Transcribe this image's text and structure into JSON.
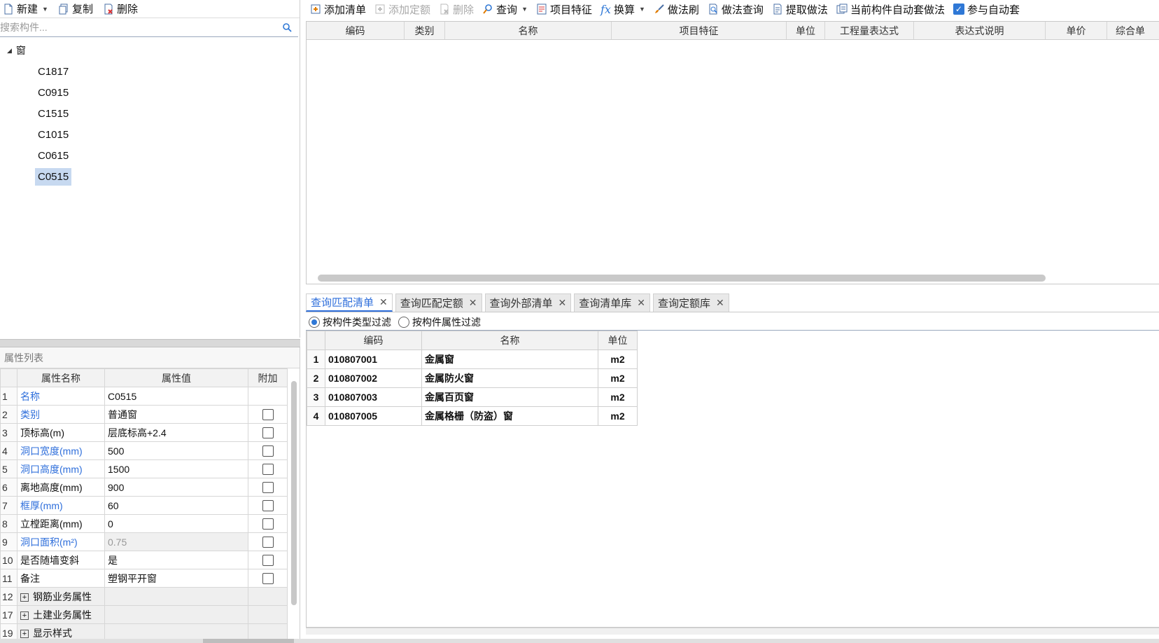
{
  "left_toolbar": {
    "new_label": "新建",
    "copy_label": "复制",
    "delete_label": "删除"
  },
  "search": {
    "placeholder": "搜索构件..."
  },
  "tree": {
    "root_label": "窗",
    "items": [
      "C1817",
      "C0915",
      "C1515",
      "C1015",
      "C0615",
      "C0515"
    ],
    "selected": "C0515"
  },
  "properties": {
    "title": "属性列表",
    "headers": [
      "属性名称",
      "属性值",
      "附加"
    ],
    "rows": [
      {
        "num": "1",
        "name": "名称",
        "value": "C0515",
        "blue": true,
        "checkbox": false,
        "grey": false
      },
      {
        "num": "2",
        "name": "类别",
        "value": "普通窗",
        "blue": true,
        "checkbox": true,
        "grey": false
      },
      {
        "num": "3",
        "name": "顶标高(m)",
        "value": "层底标高+2.4",
        "blue": false,
        "checkbox": true,
        "grey": false
      },
      {
        "num": "4",
        "name": "洞口宽度(mm)",
        "value": "500",
        "blue": true,
        "checkbox": true,
        "grey": false
      },
      {
        "num": "5",
        "name": "洞口高度(mm)",
        "value": "1500",
        "blue": true,
        "checkbox": true,
        "grey": false
      },
      {
        "num": "6",
        "name": "离地高度(mm)",
        "value": "900",
        "blue": false,
        "checkbox": true,
        "grey": false
      },
      {
        "num": "7",
        "name": "框厚(mm)",
        "value": "60",
        "blue": true,
        "checkbox": true,
        "grey": false
      },
      {
        "num": "8",
        "name": "立樘距离(mm)",
        "value": "0",
        "blue": false,
        "checkbox": true,
        "grey": false
      },
      {
        "num": "9",
        "name": "洞口面积(m²)",
        "value": "0.75",
        "blue": true,
        "checkbox": true,
        "grey": true
      },
      {
        "num": "10",
        "name": "是否随墙变斜",
        "value": "是",
        "blue": false,
        "checkbox": true,
        "grey": false
      },
      {
        "num": "11",
        "name": "备注",
        "value": "塑钢平开窗",
        "blue": false,
        "checkbox": true,
        "grey": false
      }
    ],
    "groups": [
      {
        "num": "12",
        "name": "钢筋业务属性"
      },
      {
        "num": "17",
        "name": "土建业务属性"
      },
      {
        "num": "19",
        "name": "显示样式"
      }
    ]
  },
  "right_toolbar": {
    "add_list": "添加清单",
    "add_quota": "添加定额",
    "delete": "删除",
    "query": "查询",
    "item_feature": "项目特征",
    "convert": "换算",
    "method_brush": "做法刷",
    "method_query": "做法查询",
    "extract_method": "提取做法",
    "auto_method": "当前构件自动套做法",
    "auto_apply": "参与自动套"
  },
  "list_grid": {
    "headers": [
      "编码",
      "类别",
      "名称",
      "项目特征",
      "单位",
      "工程量表达式",
      "表达式说明",
      "单价",
      "综合单"
    ]
  },
  "tabs": [
    {
      "label": "查询匹配清单",
      "active": true
    },
    {
      "label": "查询匹配定额",
      "active": false
    },
    {
      "label": "查询外部清单",
      "active": false
    },
    {
      "label": "查询清单库",
      "active": false
    },
    {
      "label": "查询定额库",
      "active": false
    }
  ],
  "filters": {
    "by_type": "按构件类型过滤",
    "by_attribute": "按构件属性过滤",
    "selected": "by_type"
  },
  "results": {
    "headers": [
      "编码",
      "名称",
      "单位"
    ],
    "rows": [
      {
        "num": "1",
        "code": "010807001",
        "name": "金属窗",
        "unit": "m2"
      },
      {
        "num": "2",
        "code": "010807002",
        "name": "金属防火窗",
        "unit": "m2"
      },
      {
        "num": "3",
        "code": "010807003",
        "name": "金属百页窗",
        "unit": "m2"
      },
      {
        "num": "4",
        "code": "010807005",
        "name": "金属格栅（防盗）窗",
        "unit": "m2"
      }
    ]
  },
  "colors": {
    "accent": "#2f78d6",
    "link_blue": "#2f6fdb",
    "selection": "#c7d9f0"
  }
}
